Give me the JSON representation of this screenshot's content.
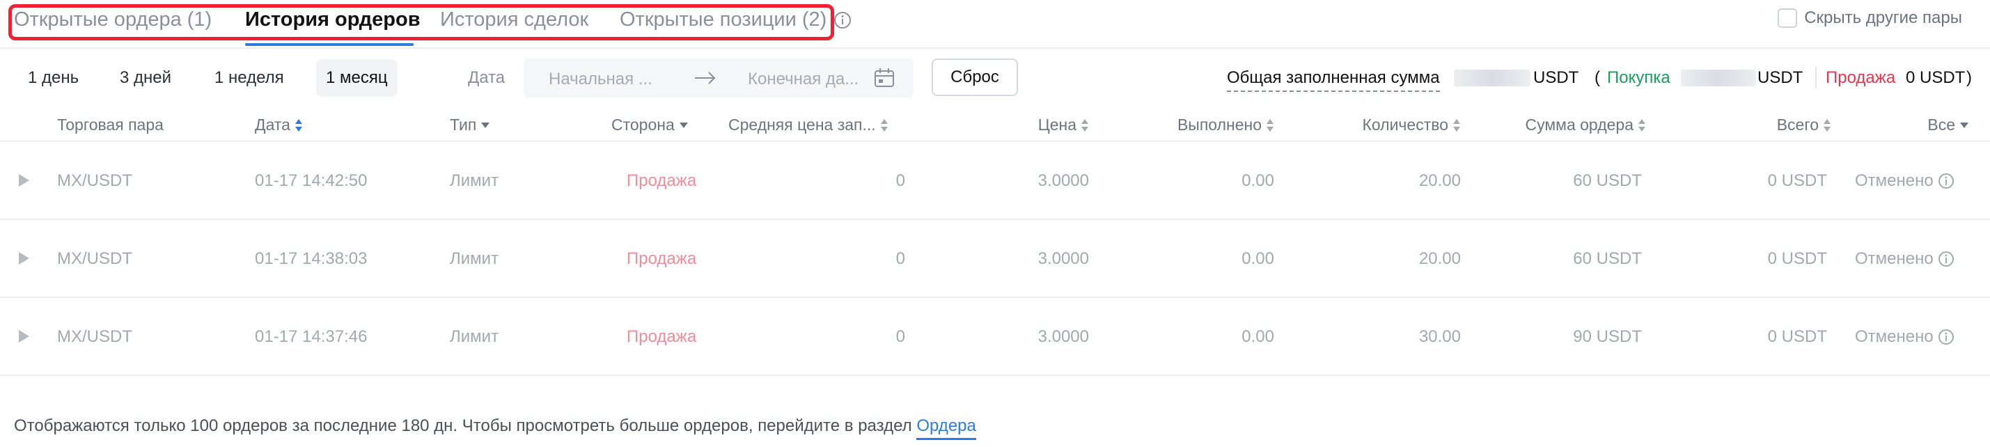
{
  "tabs": [
    {
      "label": "Открытые ордера (1)",
      "active": false
    },
    {
      "label": "История ордеров",
      "active": true
    },
    {
      "label": "История сделок",
      "active": false
    },
    {
      "label": "Открытые позиции (2)",
      "active": false
    }
  ],
  "hide_other_pairs": {
    "label": "Скрыть другие пары",
    "checked": false
  },
  "filters": {
    "ranges": [
      "1 день",
      "3 дней",
      "1 неделя",
      "1 месяц"
    ],
    "active_range": "1 месяц",
    "date_label": "Дата",
    "start_placeholder": "Начальная ...",
    "end_placeholder": "Конечная да...",
    "reset_label": "Сброс"
  },
  "summary": {
    "total_label": "Общая заполненная сумма",
    "total_unit": "USDT",
    "open_paren": "(",
    "buy_label": "Покупка",
    "buy_unit": "USDT",
    "sell_label": "Продажа",
    "sell_value": "0",
    "sell_unit": "USDT",
    "close_paren": ")"
  },
  "columns": {
    "pair": "Торговая пара",
    "date": "Дата",
    "type": "Тип",
    "side": "Сторона",
    "avg_price": "Средняя цена зап...",
    "price": "Цена",
    "filled": "Выполнено",
    "quantity": "Количество",
    "order_sum": "Сумма ордера",
    "total": "Всего",
    "all": "Все"
  },
  "rows": [
    {
      "pair": "MX/USDT",
      "date": "01-17 14:42:50",
      "type": "Лимит",
      "side": "Продажа",
      "avg_price": "0",
      "price": "3.0000",
      "filled": "0.00",
      "quantity": "20.00",
      "order_sum": "60 USDT",
      "total": "0 USDT",
      "status": "Отменено"
    },
    {
      "pair": "MX/USDT",
      "date": "01-17 14:38:03",
      "type": "Лимит",
      "side": "Продажа",
      "avg_price": "0",
      "price": "3.0000",
      "filled": "0.00",
      "quantity": "20.00",
      "order_sum": "60 USDT",
      "total": "0 USDT",
      "status": "Отменено"
    },
    {
      "pair": "MX/USDT",
      "date": "01-17 14:37:46",
      "type": "Лимит",
      "side": "Продажа",
      "avg_price": "0",
      "price": "3.0000",
      "filled": "0.00",
      "quantity": "30.00",
      "order_sum": "90 USDT",
      "total": "0 USDT",
      "status": "Отменено"
    }
  ],
  "footer": {
    "text": "Отображаются только 100 ордеров за последние 180 дн. Чтобы просмотреть больше ордеров, перейдите в раздел",
    "link": "Ордера"
  },
  "colors": {
    "accent": "#2c7be5",
    "buy": "#16a05d",
    "sell": "#f0314b",
    "highlight": "#ee2233"
  }
}
